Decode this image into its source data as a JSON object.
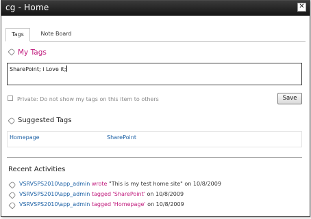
{
  "window": {
    "title": "cg - Home",
    "close_glyph": "✕"
  },
  "tabs": [
    {
      "label": "Tags",
      "selected": true
    },
    {
      "label": "Note Board",
      "selected": false
    }
  ],
  "my_tags": {
    "heading": "My Tags",
    "value": "SharePoint; i Love it;"
  },
  "private_option": {
    "label": "Private: Do not show my tags on this item to others",
    "checked": false
  },
  "save_label": "Save",
  "suggested": {
    "heading": "Suggested Tags",
    "tags": [
      "Homepage",
      "SharePoint"
    ]
  },
  "recent": {
    "heading": "Recent Activities",
    "items": [
      {
        "icon": "note-icon",
        "user": "VSRVSPS2010\\app_admin",
        "verb": "wrote",
        "text": "\"This is my test home site\"",
        "suffix": "on 10/8/2009"
      },
      {
        "icon": "tag-icon",
        "user": "VSRVSPS2010\\app_admin",
        "verb": "tagged",
        "text": "'SharePoint'",
        "suffix": "on 10/8/2009"
      },
      {
        "icon": "tag-icon",
        "user": "VSRVSPS2010\\app_admin",
        "verb": "tagged",
        "text": "'Homepage'",
        "suffix": "on 10/8/2009"
      }
    ]
  },
  "colors": {
    "accent_magenta": "#c0197c",
    "link_blue": "#1a5fa4",
    "titlebar": "#1f1f1f"
  }
}
